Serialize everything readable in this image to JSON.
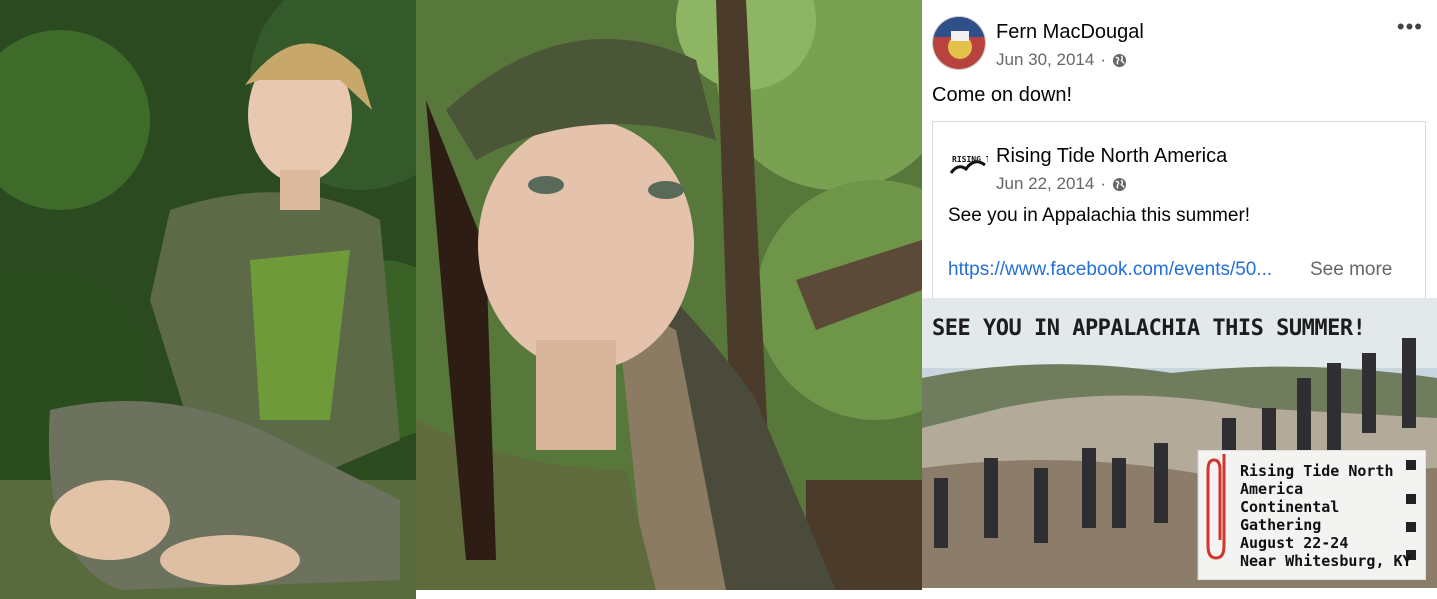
{
  "post": {
    "author": "Fern MacDougal",
    "date": "Jun 30, 2014",
    "separator": "·",
    "privacy_icon": "globe-icon",
    "more_icon": "•••",
    "text": "Come on down!"
  },
  "shared_post": {
    "author": "Rising Tide North America",
    "date": "Jun 22, 2014",
    "separator": "·",
    "privacy_icon": "globe-icon",
    "logo_text": "RISING TIDE",
    "text": "See you in Appalachia this summer!",
    "link": "https://www.facebook.com/events/50...",
    "see_more": "See more"
  },
  "event_image": {
    "headline": "SEE YOU IN APPALACHIA THIS SUMMER!",
    "note_lines": [
      "Rising Tide North",
      "America",
      "Continental",
      "Gathering",
      "August 22-24",
      "Near Whitesburg, KY"
    ]
  },
  "colors": {
    "link": "#216fdb",
    "meta": "#65676b",
    "text": "#050505"
  }
}
